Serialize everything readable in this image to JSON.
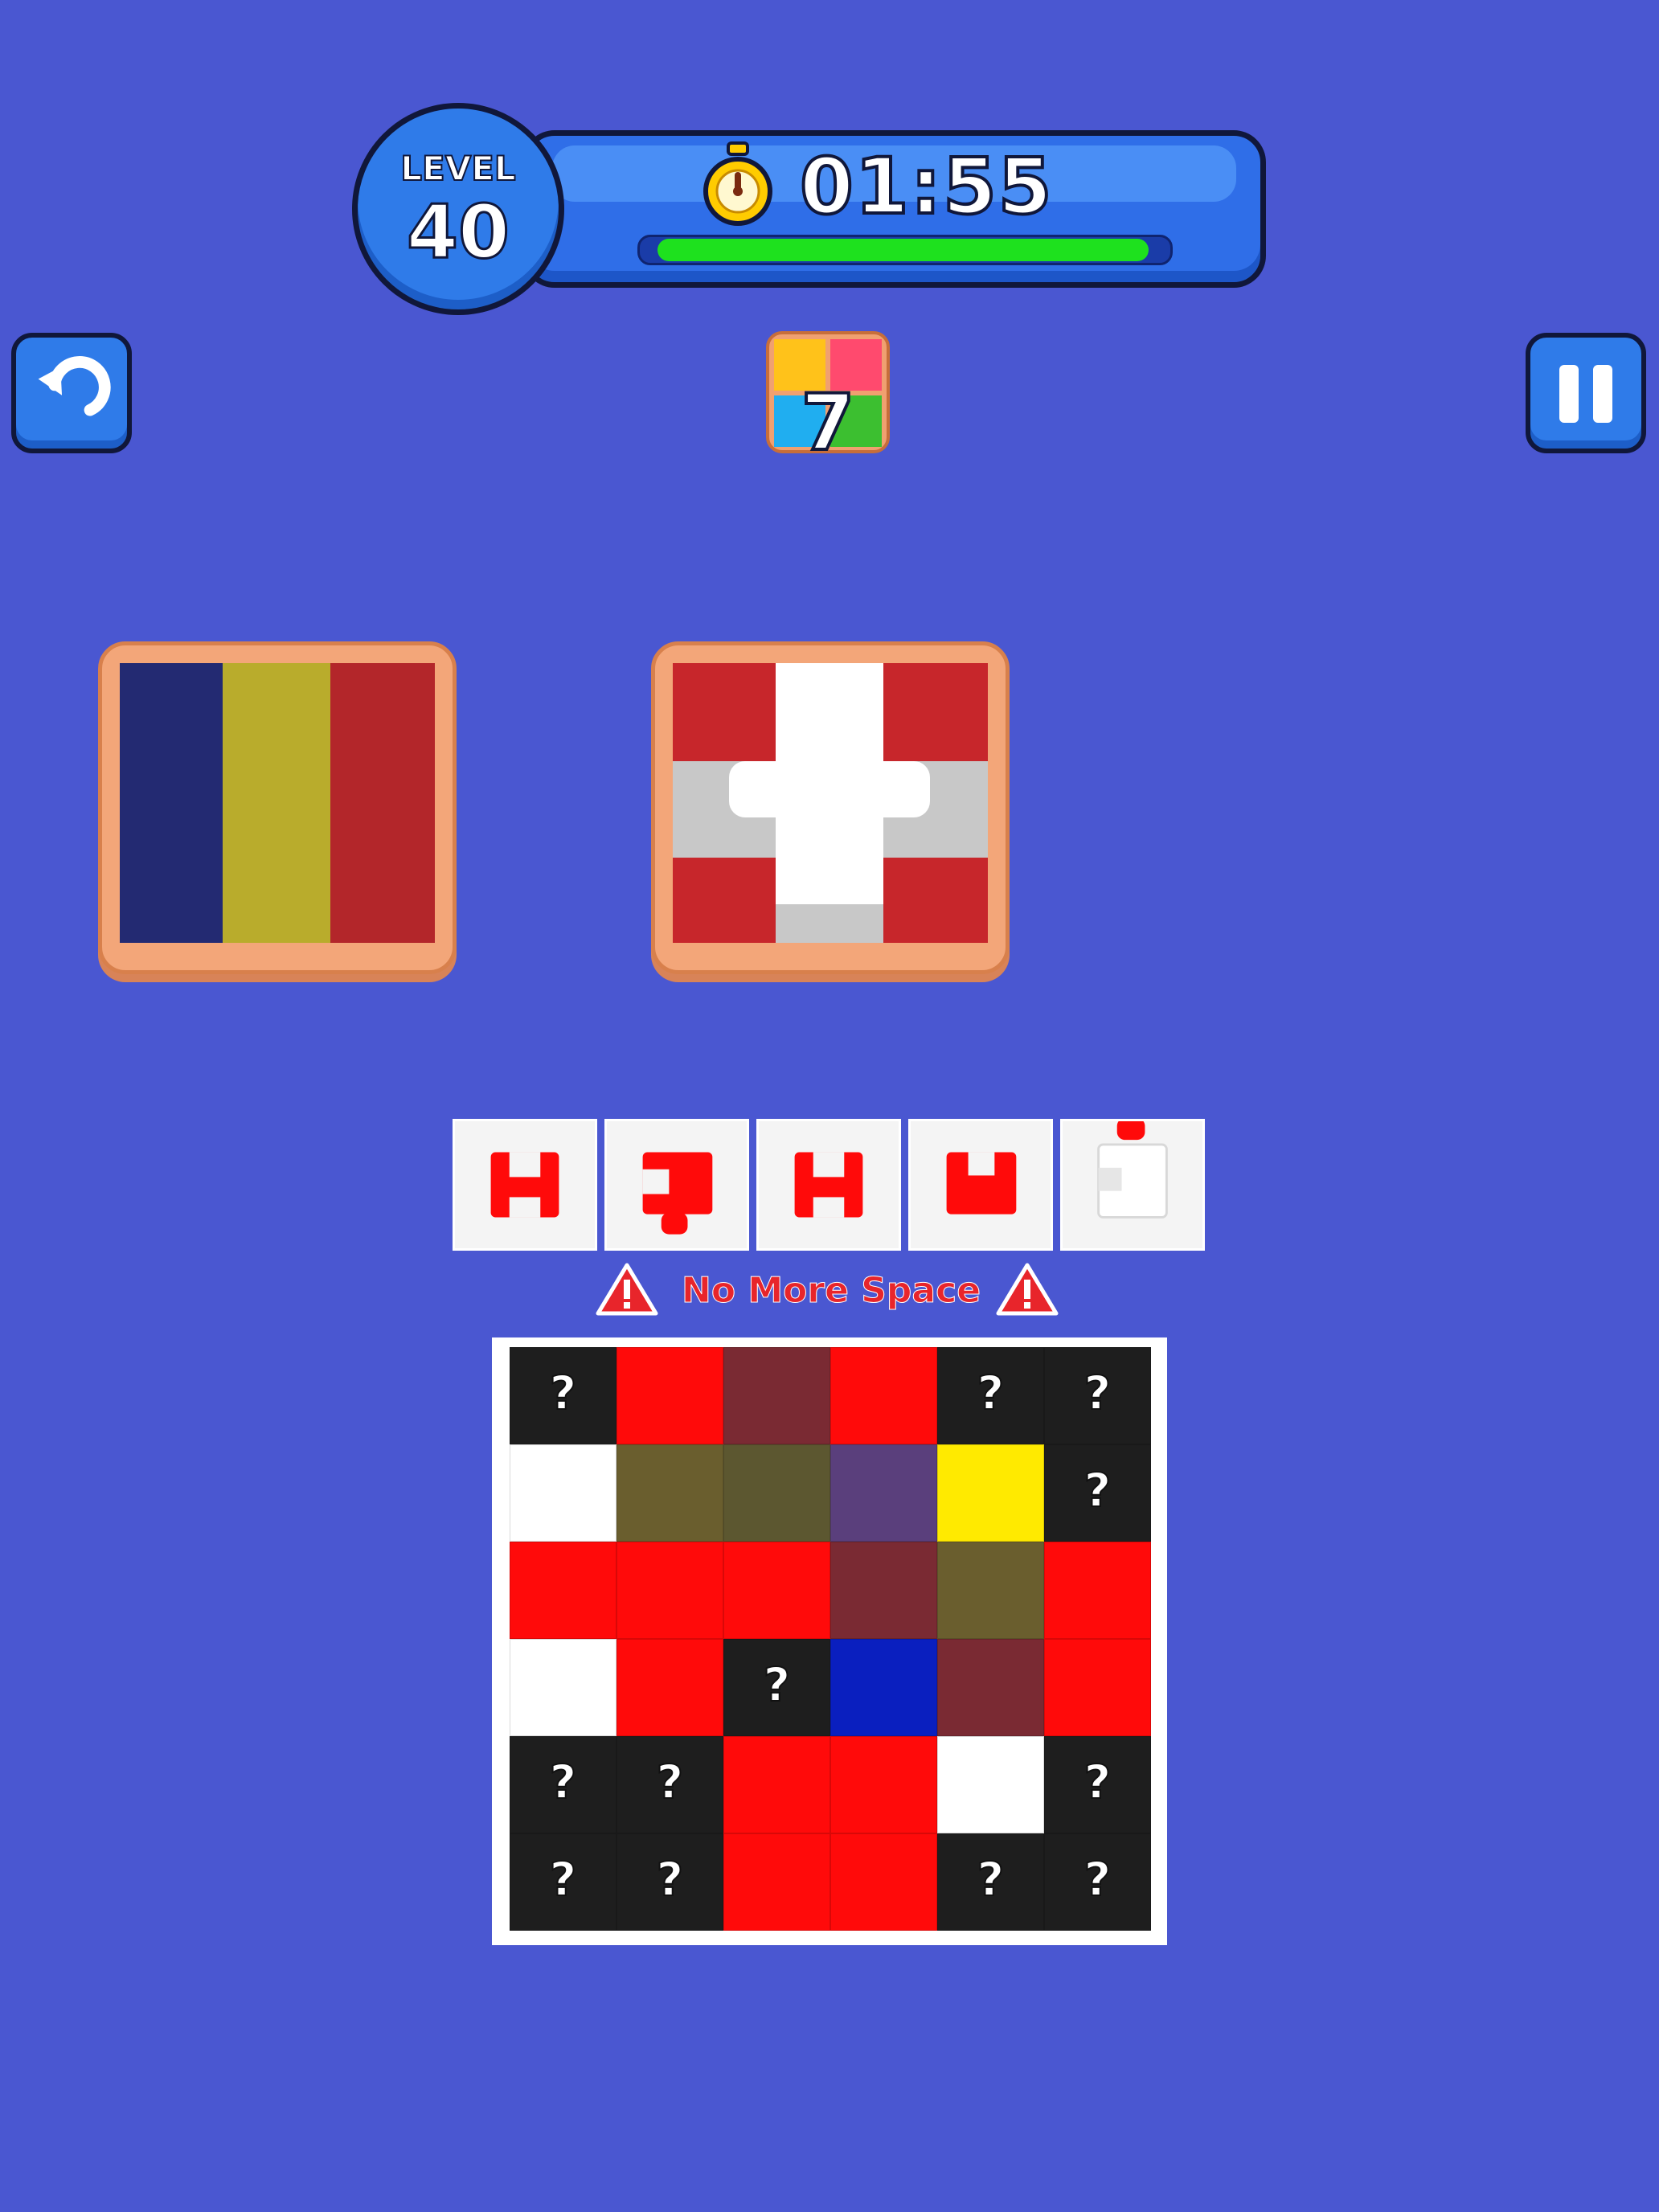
{
  "header": {
    "level_label": "LEVEL",
    "level_number": "40",
    "timer": "01:55",
    "time_remaining_fraction": 0.97
  },
  "buttons": {
    "undo_icon": "undo-arrow-icon",
    "pause_icon": "pause-icon"
  },
  "puzzle_counter": {
    "icon": "puzzle-pieces-icon",
    "count": "7"
  },
  "targets": [
    {
      "name": "romania-flag",
      "colors": [
        "#232a72",
        "#b9ac2c",
        "#b3262a"
      ]
    },
    {
      "name": "swiss-flag",
      "colors": [
        "#c7262b",
        "#ffffff",
        "#c8c8c8"
      ]
    }
  ],
  "tray": {
    "slots": [
      {
        "piece_color": "#ff0a0a",
        "shape": "h-piece"
      },
      {
        "piece_color": "#ff0a0a",
        "shape": "corner-piece"
      },
      {
        "piece_color": "#ff0a0a",
        "shape": "h-piece"
      },
      {
        "piece_color": "#ff0a0a",
        "shape": "cup-piece"
      },
      {
        "piece_color": "#ffffff",
        "shape": "white-piece-red-tab"
      }
    ],
    "warning_text": "No More Space"
  },
  "board": {
    "rows": [
      [
        {
          "c": "#1e1e1e",
          "q": "?"
        },
        {
          "c": "#ff0a0a",
          "q": ""
        },
        {
          "c": "#7a2a33",
          "q": ""
        },
        {
          "c": "#ff0a0a",
          "q": ""
        },
        {
          "c": "#1e1e1e",
          "q": "?"
        },
        {
          "c": "#1e1e1e",
          "q": "?"
        }
      ],
      [
        {
          "c": "#ffffff",
          "q": ""
        },
        {
          "c": "#6a5e2e",
          "q": ""
        },
        {
          "c": "#5c5730",
          "q": ""
        },
        {
          "c": "#5a3f7c",
          "q": ""
        },
        {
          "c": "#ffea00",
          "q": ""
        },
        {
          "c": "#1e1e1e",
          "q": "?"
        }
      ],
      [
        {
          "c": "#ff0a0a",
          "q": ""
        },
        {
          "c": "#ff0a0a",
          "q": ""
        },
        {
          "c": "#ff0a0a",
          "q": ""
        },
        {
          "c": "#7a2a33",
          "q": ""
        },
        {
          "c": "#6a5e2e",
          "q": ""
        },
        {
          "c": "#ff0a0a",
          "q": ""
        }
      ],
      [
        {
          "c": "#ffffff",
          "q": ""
        },
        {
          "c": "#ff0a0a",
          "q": ""
        },
        {
          "c": "#1e1e1e",
          "q": "?"
        },
        {
          "c": "#0a1fbf",
          "q": ""
        },
        {
          "c": "#7a2a33",
          "q": ""
        },
        {
          "c": "#ff0a0a",
          "q": ""
        }
      ],
      [
        {
          "c": "#1e1e1e",
          "q": "?"
        },
        {
          "c": "#1e1e1e",
          "q": "?"
        },
        {
          "c": "#ff0a0a",
          "q": ""
        },
        {
          "c": "#ff0a0a",
          "q": ""
        },
        {
          "c": "#ffffff",
          "q": ""
        },
        {
          "c": "#1e1e1e",
          "q": "?"
        }
      ],
      [
        {
          "c": "#1e1e1e",
          "q": "?"
        },
        {
          "c": "#1e1e1e",
          "q": "?"
        },
        {
          "c": "#ff0a0a",
          "q": ""
        },
        {
          "c": "#ff0a0a",
          "q": ""
        },
        {
          "c": "#1e1e1e",
          "q": "?"
        },
        {
          "c": "#1e1e1e",
          "q": "?"
        }
      ]
    ]
  }
}
